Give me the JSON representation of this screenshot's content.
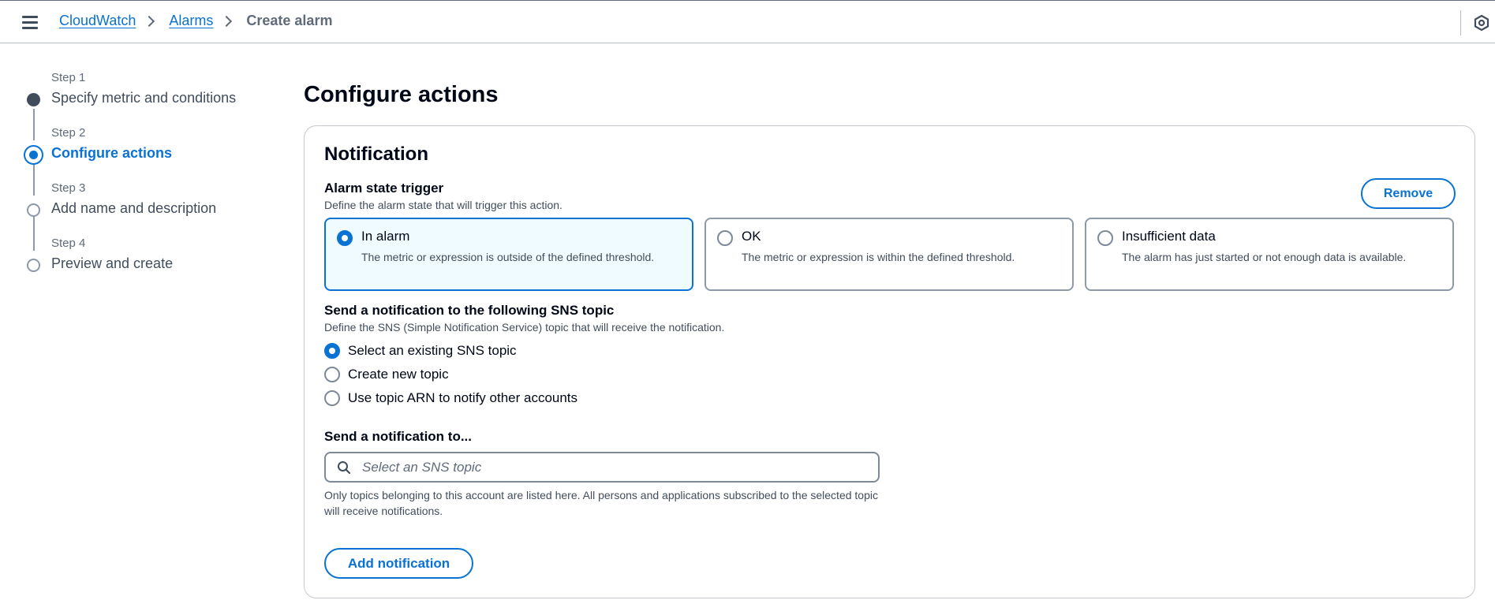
{
  "breadcrumb": {
    "items": [
      "CloudWatch",
      "Alarms"
    ],
    "current": "Create alarm"
  },
  "steps": [
    {
      "number": "Step 1",
      "title": "Specify metric and conditions",
      "state": "done"
    },
    {
      "number": "Step 2",
      "title": "Configure actions",
      "state": "active"
    },
    {
      "number": "Step 3",
      "title": "Add name and description",
      "state": "pending"
    },
    {
      "number": "Step 4",
      "title": "Preview and create",
      "state": "pending"
    }
  ],
  "page": {
    "title": "Configure actions"
  },
  "notification": {
    "title": "Notification",
    "remove_label": "Remove",
    "trigger": {
      "label": "Alarm state trigger",
      "description": "Define the alarm state that will trigger this action.",
      "options": [
        {
          "title": "In alarm",
          "description": "The metric or expression is outside of the defined threshold.",
          "selected": true
        },
        {
          "title": "OK",
          "description": "The metric or expression is within the defined threshold.",
          "selected": false
        },
        {
          "title": "Insufficient data",
          "description": "The alarm has just started or not enough data is available.",
          "selected": false
        }
      ]
    },
    "sns": {
      "label": "Send a notification to the following SNS topic",
      "description": "Define the SNS (Simple Notification Service) topic that will receive the notification.",
      "options": [
        {
          "label": "Select an existing SNS topic",
          "selected": true
        },
        {
          "label": "Create new topic",
          "selected": false
        },
        {
          "label": "Use topic ARN to notify other accounts",
          "selected": false
        }
      ]
    },
    "send_to": {
      "label": "Send a notification to...",
      "placeholder": "Select an SNS topic",
      "help": "Only topics belonging to this account are listed here. All persons and applications subscribed to the selected topic will receive notifications."
    },
    "add_label": "Add notification"
  },
  "colors": {
    "accent": "#0972d3",
    "text": "#000716",
    "muted": "#414d5c",
    "border": "#8d99a8"
  },
  "icons": {
    "menu": "hamburger-menu-icon",
    "search": "search-icon",
    "settings": "hexagon-settings-icon"
  }
}
